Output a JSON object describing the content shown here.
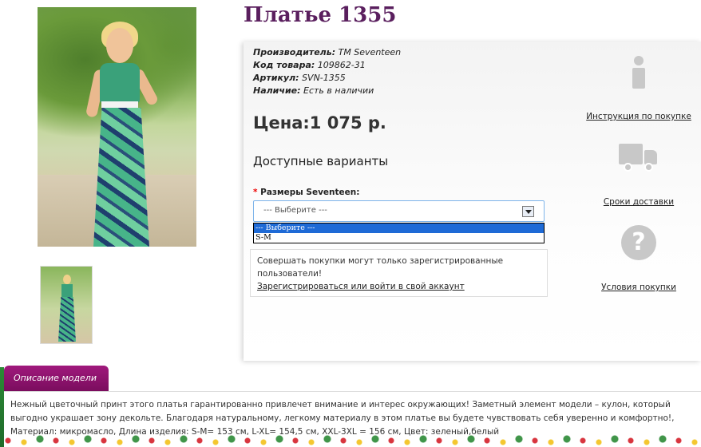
{
  "product": {
    "title": "Платье 1355",
    "meta": [
      {
        "label": "Производитель:",
        "value": "TM Seventeen"
      },
      {
        "label": "Код товара:",
        "value": "109862-31"
      },
      {
        "label": "Артикул:",
        "value": "SVN-1355"
      },
      {
        "label": "Наличие:",
        "value": "Есть в наличии"
      }
    ],
    "price": "Цена:1 075 р.",
    "variants_heading": "Доступные варианты",
    "size": {
      "required_mark": "*",
      "label": "Размеры Seventeen:",
      "selected": "--- Выберите ---",
      "options": [
        "--- Выберите ---",
        "S-M"
      ]
    },
    "notice": {
      "text": "Совершать покупки могут только зарегистрированные пользователи!",
      "link": "Зарегистрироваться или войти в свой аккаунт"
    }
  },
  "side_links": [
    {
      "label": "Инструкция по покупке",
      "icon": "info-icon"
    },
    {
      "label": "Сроки доставки",
      "icon": "truck-icon"
    },
    {
      "label": "Условия покупки",
      "icon": "question-icon"
    }
  ],
  "description": {
    "tab": "Описание модели",
    "text": "Нежный цветочный принт этого платья гарантированно привлечет внимание и интерес окружающих! Заметный элемент модели – кулон, который выгодно украшает зону декольте. Благодаря натуральному, легкому материалу в этом платье вы будете чувствовать себя уверенно и комфортно!, Материал: микромасло, Длина изделия: S-M= 153 см, L-XL= 154,5 см, XXL-3XL = 156 см, Цвет: зеленый,белый"
  },
  "colors": {
    "title": "#5a1f5e",
    "tab": "#8e1370",
    "dropdown_highlight": "#1e6ad6"
  }
}
